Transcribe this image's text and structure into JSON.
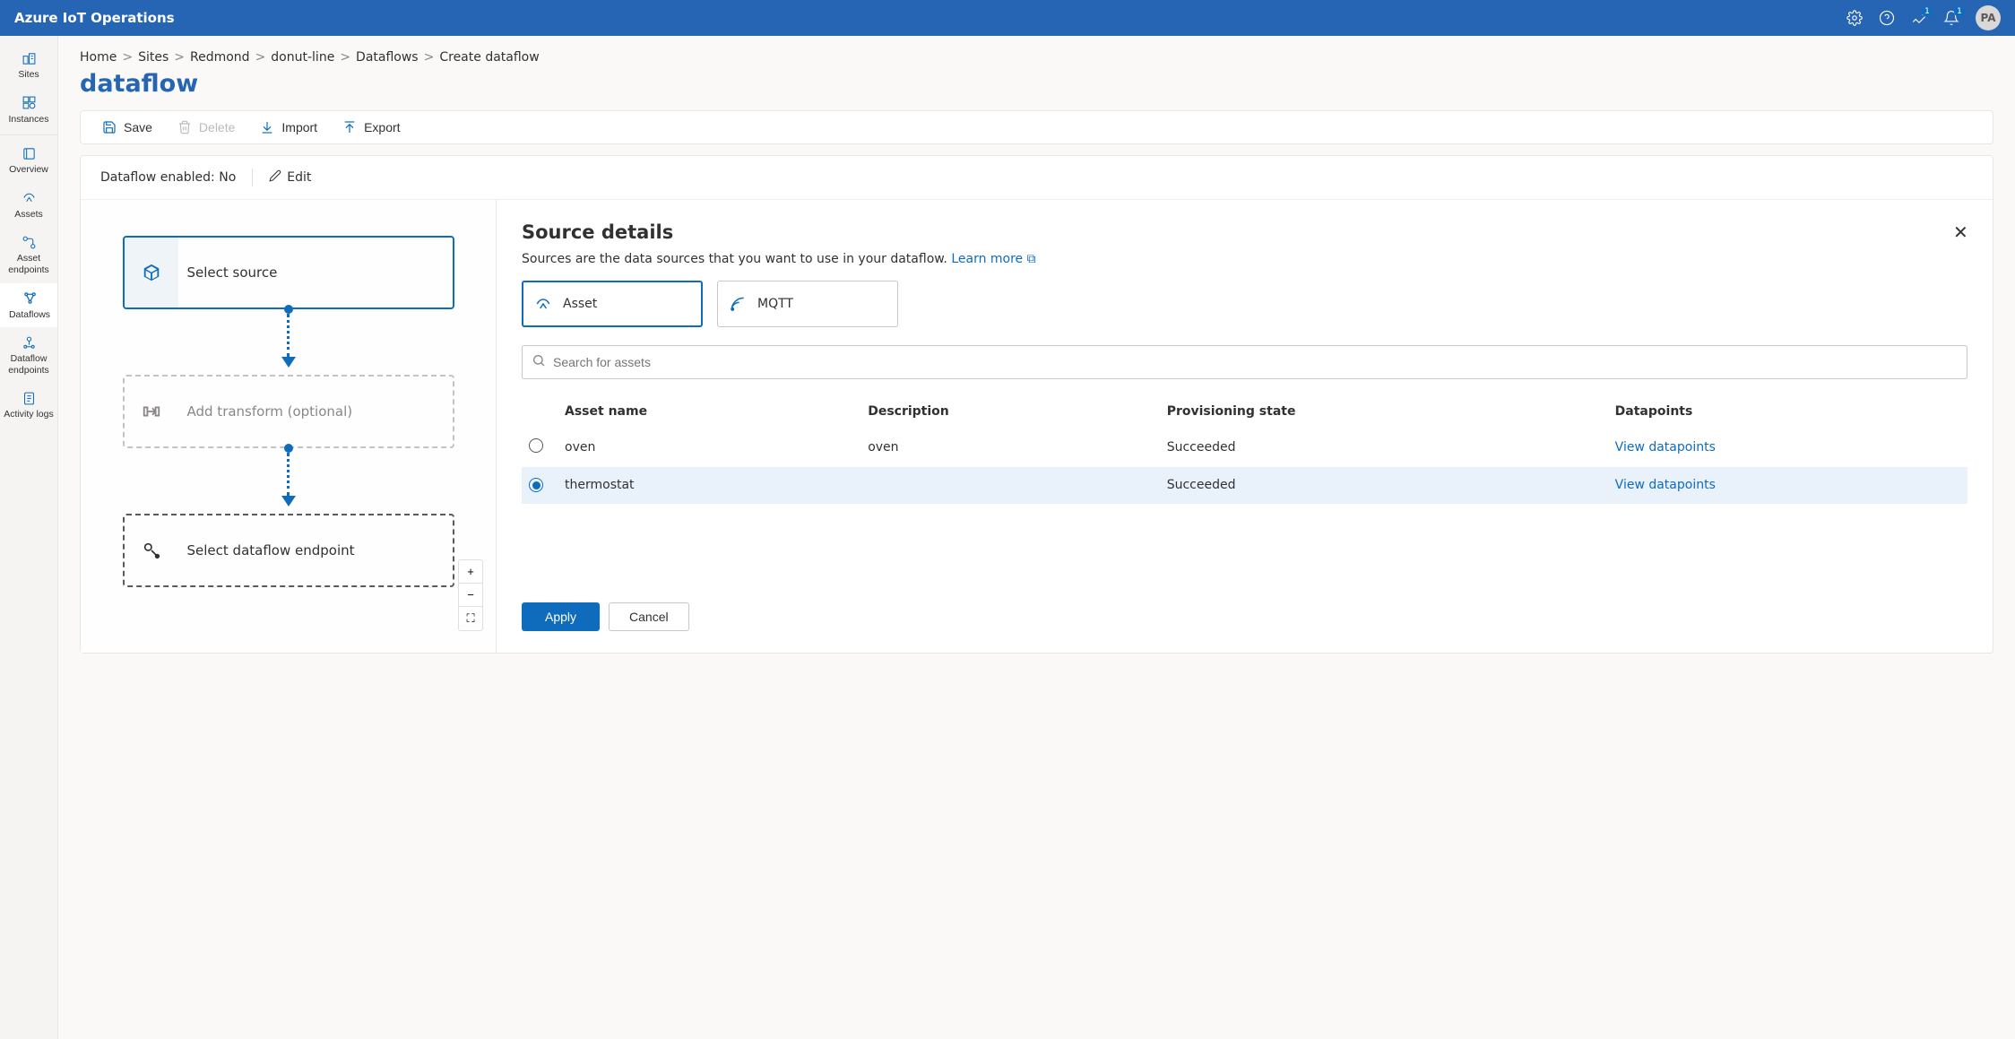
{
  "header": {
    "title": "Azure IoT Operations",
    "notifications1": "1",
    "notifications2": "1",
    "avatar_initials": "PA"
  },
  "sidebar": {
    "items": [
      {
        "label": "Sites"
      },
      {
        "label": "Instances"
      },
      {
        "label": "Overview"
      },
      {
        "label": "Assets"
      },
      {
        "label": "Asset endpoints"
      },
      {
        "label": "Dataflows"
      },
      {
        "label": "Dataflow endpoints"
      },
      {
        "label": "Activity logs"
      }
    ]
  },
  "breadcrumb": [
    {
      "label": "Home"
    },
    {
      "label": "Sites"
    },
    {
      "label": "Redmond"
    },
    {
      "label": "donut-line"
    },
    {
      "label": "Dataflows"
    },
    {
      "label": "Create dataflow"
    }
  ],
  "page_title": "dataflow",
  "cmdbar": {
    "save": "Save",
    "delete": "Delete",
    "import": "Import",
    "export": "Export"
  },
  "status": {
    "text": "Dataflow enabled: No",
    "edit": "Edit"
  },
  "flow": {
    "source_label": "Select source",
    "transform_label": "Add transform (optional)",
    "dest_label": "Select dataflow endpoint"
  },
  "source_details": {
    "title": "Source details",
    "desc_text": "Sources are the data sources that you want to use in your dataflow. ",
    "learn_more": "Learn more",
    "tab_asset": "Asset",
    "tab_mqtt": "MQTT",
    "search_placeholder": "Search for assets",
    "headers": {
      "name": "Asset name",
      "desc": "Description",
      "state": "Provisioning state",
      "dp": "Datapoints"
    },
    "rows": [
      {
        "name": "oven",
        "desc": "oven",
        "state": "Succeeded",
        "dp": "View datapoints",
        "selected": false
      },
      {
        "name": "thermostat",
        "desc": "",
        "state": "Succeeded",
        "dp": "View datapoints",
        "selected": true
      }
    ],
    "apply": "Apply",
    "cancel": "Cancel"
  }
}
